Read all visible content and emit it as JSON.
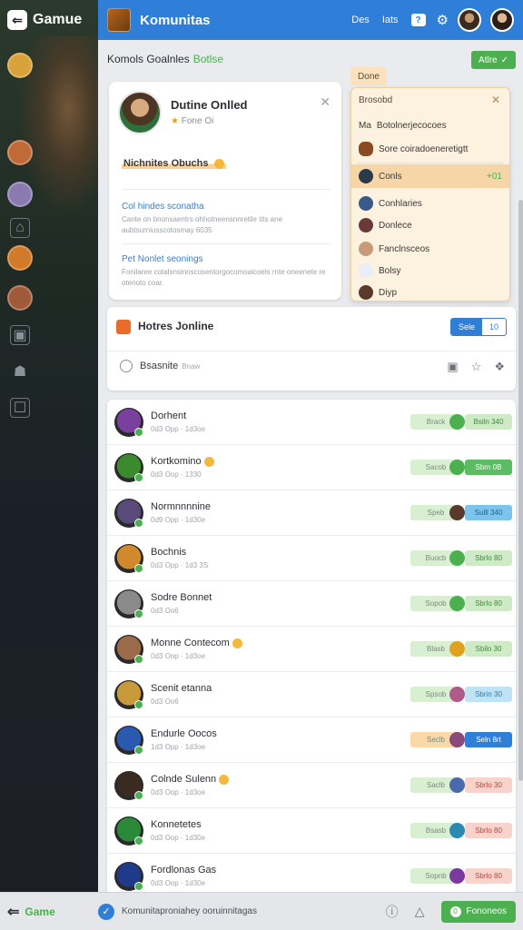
{
  "app": {
    "brand": "Gamue",
    "brand_icon": "gamepad-icon"
  },
  "topbar": {
    "title": "Komunitas",
    "link1": "Des",
    "link2": "Iats",
    "help": "?",
    "accent": "#2f7fd8"
  },
  "section": {
    "title": "Komols Goalnles",
    "tag": "Botlse",
    "action": "Atlre"
  },
  "profile": {
    "name": "Dutine Onlled",
    "sub": "Fone Oi",
    "highlight": "Nichnites Obuchs",
    "link1": "Col hindes sconatha",
    "text1": "Cante on bnonsaentrs ohhotneensnnretile tits ane aubtsurniusscotosmay 6035",
    "link2": "Pet Nonlet seonings",
    "text2": "Fonilanre cotalsnsinnscosentorgocomoalcoels rnte oneenete re otenoto coar."
  },
  "dropdown": {
    "tab": "Done",
    "header": "Brosobd",
    "items": [
      {
        "label": "Botolnerjecocoes",
        "prefix": "Ma",
        "right": ""
      },
      {
        "label": "Sore coiradoeneretigtt",
        "prefix": "",
        "right": ""
      },
      {
        "label": "Conls",
        "prefix": "",
        "right": "+01"
      },
      {
        "label": "Conhlaries",
        "prefix": "",
        "right": ""
      },
      {
        "label": "Donlece",
        "prefix": "",
        "right": ""
      },
      {
        "label": "Fanclnsceos",
        "prefix": "",
        "right": ""
      },
      {
        "label": "Bolsy",
        "prefix": "",
        "right": ""
      },
      {
        "label": "Diyp",
        "prefix": "",
        "right": ""
      }
    ]
  },
  "online": {
    "title": "Hotres Jonline",
    "seg_a": "Sele",
    "seg_b": "10",
    "search": "Bsasnite",
    "search_small": "Bnaw"
  },
  "rows": [
    {
      "name": "Dorhent",
      "meta": "0d3 Opp · 1d3oe",
      "pill1": "Brack",
      "pill2": "Bsiln 340",
      "p2color": "#cfeac7",
      "p2text": "#3d8b3d",
      "dot": "#4caf50",
      "av": "#7b3fa0"
    },
    {
      "name": "Kortkomino",
      "meta": "0d3 Oop · 1330",
      "pill1": "Sacob",
      "pill2": "Sbrn 0B",
      "p2color": "#5dbb63",
      "p2text": "#ffffff",
      "dot": "#4caf50",
      "av": "#3b8a2d"
    },
    {
      "name": "Normnnnnine",
      "meta": "0d9 Opp · 1d30e",
      "pill1": "Speb",
      "pill2": "Sulll 340",
      "p2color": "#7cc3ee",
      "p2text": "#1d5f93",
      "dot": "#5a3a2a",
      "av": "#5a4a7a"
    },
    {
      "name": "Bochnis",
      "meta": "0d3 Opp · 1d3 3S",
      "pill1": "Buocb",
      "pill2": "Sbrlo 80",
      "p2color": "#cfeac7",
      "p2text": "#3d8b3d",
      "dot": "#4caf50",
      "av": "#d08a2b"
    },
    {
      "name": "Sodre Bonnet",
      "meta": "0d3 Oo6",
      "pill1": "Sopob",
      "pill2": "Sbrlo 80",
      "p2color": "#cfeac7",
      "p2text": "#3d8b3d",
      "dot": "#4caf50",
      "av": "#8a8a8a"
    },
    {
      "name": "Monne Contecom",
      "meta": "0d3 Oop · 1d3oe",
      "pill1": "Blasb",
      "pill2": "Sbilo 30",
      "p2color": "#cfeac7",
      "p2text": "#3d8b3d",
      "dot": "#e0a21c",
      "av": "#9a6a4a"
    },
    {
      "name": "Scenit etanna",
      "meta": "0d3 Oo6",
      "pill1": "Spsob",
      "pill2": "Sbrin 30",
      "p2color": "#bfe2f4",
      "p2text": "#2a7db0",
      "dot": "#b05a8a",
      "av": "#c89a3a"
    },
    {
      "name": "Endurle Oocos",
      "meta": "1d3 Opp · 1d3oe",
      "pill1": "Seclb",
      "pill2": "Seln 8rt",
      "p2color": "#2f7fd8",
      "p2text": "#ffffff",
      "dot": "#8a4a7a",
      "av": "#2a5ab0",
      "p1color": "#fbd8a8"
    },
    {
      "name": "Colnde Sulenn",
      "meta": "0d3 Oop · 1d3oe",
      "pill1": "Saclb",
      "pill2": "Sbrlo 30",
      "p2color": "#f7d3cc",
      "p2text": "#c0453a",
      "dot": "#4a6ab0",
      "av": "#3a2a22"
    },
    {
      "name": "Konnetetes",
      "meta": "0d3 Oop · 1d30e",
      "pill1": "Bsasb",
      "pill2": "Sbrlo 80",
      "p2color": "#f7d3cc",
      "p2text": "#c0453a",
      "dot": "#2a8ab0",
      "av": "#2a8a3a"
    },
    {
      "name": "Fordlonas Gas",
      "meta": "0d3 Oop · 1d30e",
      "pill1": "Sopnb",
      "pill2": "Sbrlo 80",
      "p2color": "#f7d3cc",
      "p2text": "#c0453a",
      "dot": "#7a3aa0",
      "av": "#1f3a8a"
    }
  ],
  "bottombar": {
    "brand": "Game",
    "text": "Komunitaproniahey ooruinnitagas",
    "button": "Fononeos",
    "button_num": "0"
  }
}
